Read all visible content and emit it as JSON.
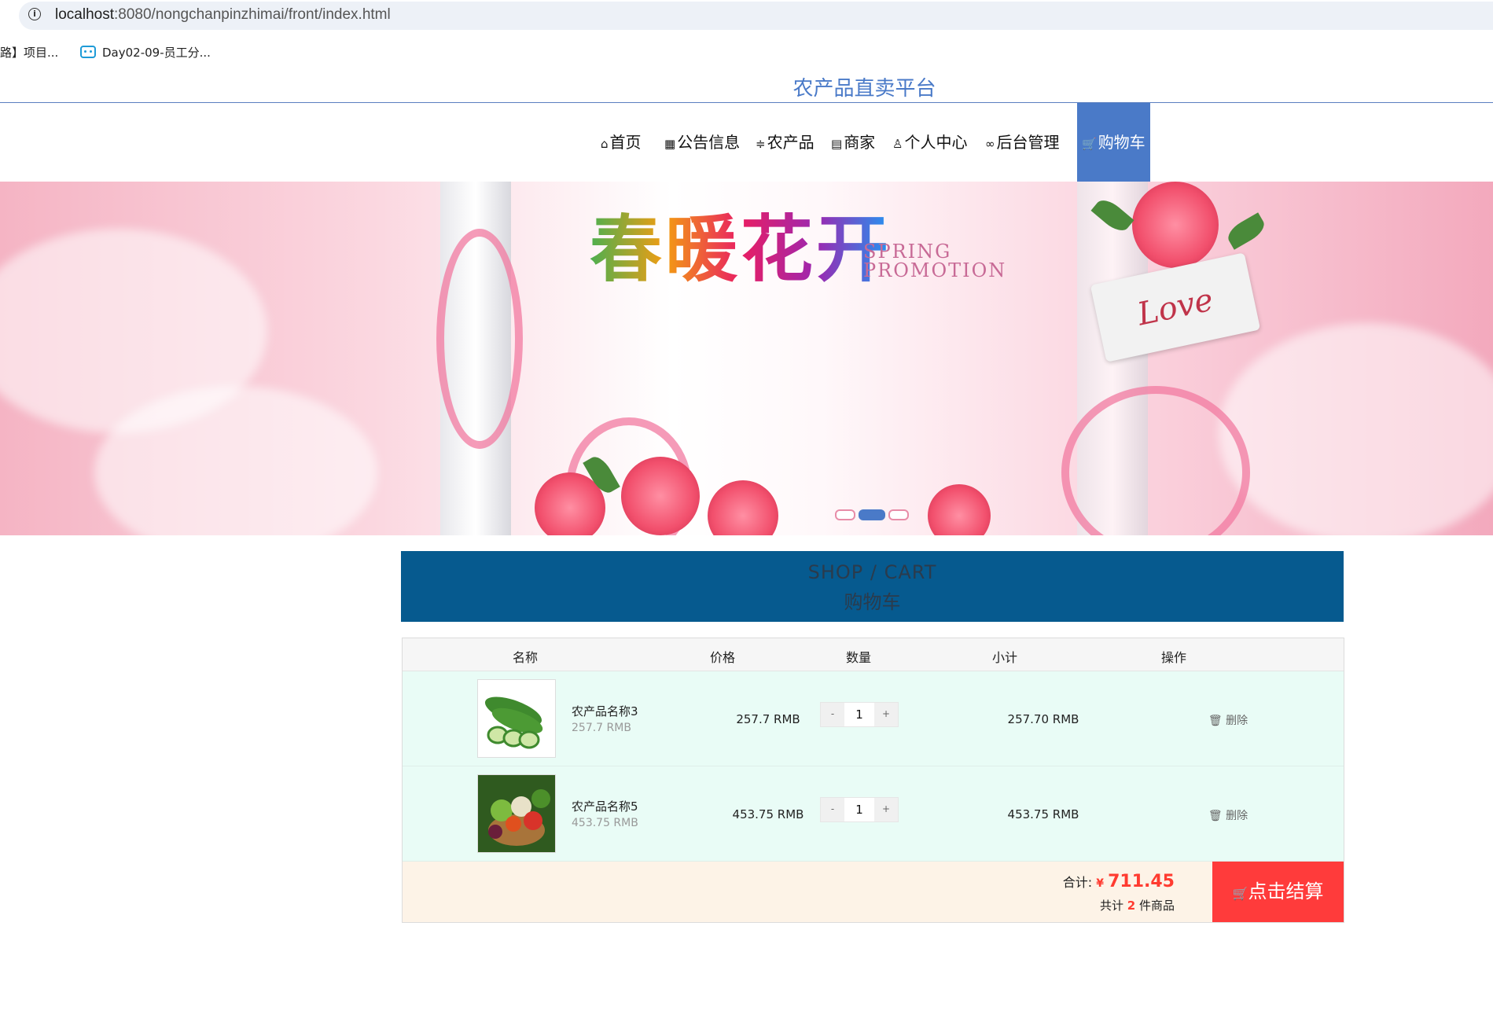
{
  "browser": {
    "url_host": "localhost",
    "url_rest": ":8080/nongchanpinzhimai/front/index.html",
    "bookmarks": [
      {
        "label": "路】项目..."
      },
      {
        "label": "Day02-09-员工分..."
      }
    ]
  },
  "site": {
    "title": "农产品直卖平台"
  },
  "nav": {
    "items": [
      {
        "icon": "⌂",
        "label": "首页"
      },
      {
        "icon": "▦",
        "label": "公告信息"
      },
      {
        "icon": "≑",
        "label": "农产品"
      },
      {
        "icon": "▤",
        "label": "商家"
      },
      {
        "icon": "♙",
        "label": "个人中心"
      },
      {
        "icon": "∞",
        "label": "后台管理"
      },
      {
        "icon": "🛒",
        "label": "购物车"
      }
    ],
    "active_index": 6
  },
  "banner": {
    "headline": "春暖花开",
    "sub1": "SPRING",
    "sub2": "PROMOTION",
    "card_text": "Love",
    "slides": 3,
    "active_slide": 1
  },
  "cart": {
    "heading_en": "SHOP / CART",
    "heading_zh": "购物车",
    "columns": [
      "名称",
      "价格",
      "数量",
      "小计",
      "操作"
    ],
    "rows": [
      {
        "name": "农产品名称3",
        "unit_price": "257.7 RMB",
        "price": "257.7 RMB",
        "qty": "1",
        "subtotal": "257.70 RMB",
        "action": "删除"
      },
      {
        "name": "农产品名称5",
        "unit_price": "453.75 RMB",
        "price": "453.75 RMB",
        "qty": "1",
        "subtotal": "453.75 RMB",
        "action": "删除"
      }
    ],
    "minus": "-",
    "plus": "+",
    "total_label": "合计:",
    "currency": "¥",
    "total": "711.45",
    "count_prefix": "共计",
    "count": "2",
    "count_suffix": "件商品",
    "checkout_label": "点击结算"
  },
  "colors": {
    "accent": "#4a7ac8",
    "cart_header": "#065a8f",
    "row_bg": "#e9fcf6",
    "footer_bg": "#fdf3e7",
    "checkout": "#ff3b3b"
  }
}
